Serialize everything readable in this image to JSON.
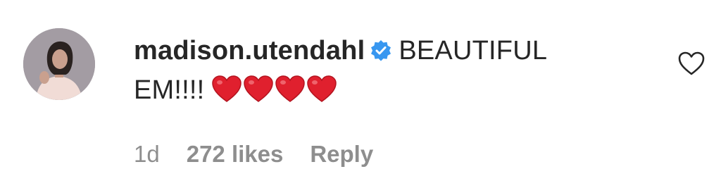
{
  "comment": {
    "username": "madison.utendahl",
    "text_line1": "BEAUTIFUL",
    "text_line2": "EM!!!!",
    "hearts": [
      "red-heart-emoji",
      "red-heart-emoji",
      "red-heart-emoji",
      "red-heart-emoji"
    ],
    "time": "1d",
    "likes": "272 likes",
    "reply": "Reply",
    "verified": true
  },
  "icons": {
    "verified_badge": "verified-badge-icon",
    "like": "heart-outline-icon"
  },
  "colors": {
    "text": "#262626",
    "meta": "#8e8e8e",
    "verified_blue": "#3897f0",
    "heart_red": "#e0202e"
  }
}
